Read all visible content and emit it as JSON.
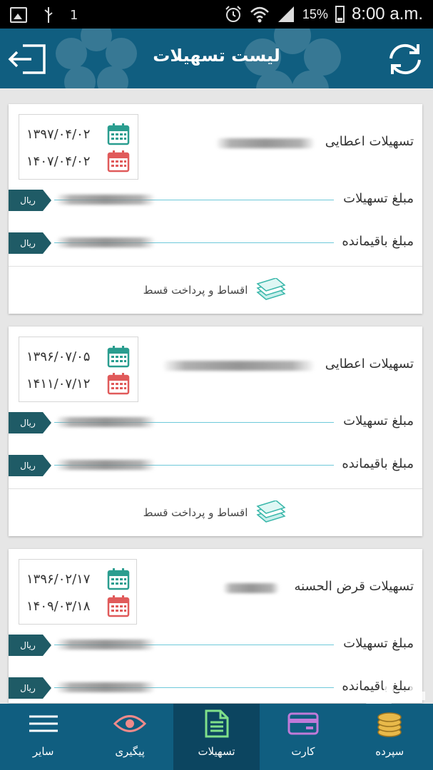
{
  "status_bar": {
    "sim": "1",
    "battery": "15%",
    "time": "8:00 a.m.",
    "icons": [
      "image-icon",
      "usb-icon",
      "alarm-icon",
      "wifi-icon",
      "signal-icon",
      "battery-icon"
    ]
  },
  "header": {
    "title": "لیست تسهیلات",
    "icons": [
      "logout-icon",
      "refresh-icon"
    ],
    "color": "#105e80"
  },
  "loans": [
    {
      "type_label": "تسهیلات اعطایی",
      "start_date": "۱۳۹۷/۰۴/۰۲",
      "end_date": "۱۴۰۷/۰۴/۰۲",
      "amount_label": "مبلغ تسهیلات",
      "remaining_label": "مبلغ باقیمانده",
      "currency": "ریال",
      "action_label": "اقساط و پرداخت قسط"
    },
    {
      "type_label": "تسهیلات اعطایی",
      "start_date": "۱۳۹۶/۰۷/۰۵",
      "end_date": "۱۴۱۱/۰۷/۱۲",
      "amount_label": "مبلغ تسهیلات",
      "remaining_label": "مبلغ باقیمانده",
      "currency": "ریال",
      "action_label": "اقساط و پرداخت قسط"
    },
    {
      "type_label": "تسهیلات قرض الحسنه",
      "start_date": "۱۳۹۶/۰۲/۱۷",
      "end_date": "۱۴۰۹/۰۳/۱۸",
      "amount_label": "مبلغ تسهیلات",
      "remaining_label": "مبلغ باقیمانده",
      "currency": "ریال"
    }
  ],
  "bottom_nav": [
    {
      "label": "سایر",
      "icon": "menu-icon"
    },
    {
      "label": "پیگیری",
      "icon": "eye-icon"
    },
    {
      "label": "تسهیلات",
      "icon": "document-icon",
      "active": true
    },
    {
      "label": "کارت",
      "icon": "card-icon"
    },
    {
      "label": "سپرده",
      "icon": "coins-icon"
    }
  ],
  "colors": {
    "accent": "#105e80",
    "tag": "#1f5b66",
    "line": "#6ec9da",
    "calendar_start": "#2a9d8f",
    "calendar_end": "#e05a5a"
  }
}
